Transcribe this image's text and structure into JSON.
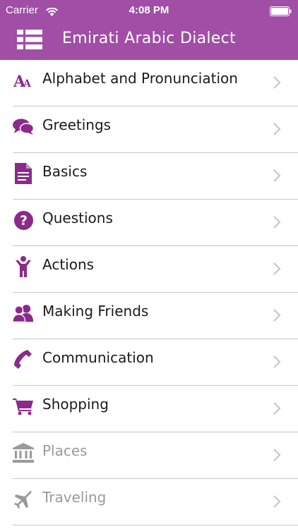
{
  "status_bar": {
    "carrier": "Carrier",
    "time": "4:08 PM"
  },
  "header": {
    "title": "Emirati Arabic Dialect"
  },
  "colors": {
    "accent": "#a04ea6",
    "icon": "#8b2a8b",
    "disabled": "#9a9a9a"
  },
  "items": [
    {
      "label": "Alphabet and Pronunciation",
      "icon": "font-size-icon",
      "enabled": true
    },
    {
      "label": "Greetings",
      "icon": "chat-bubbles-icon",
      "enabled": true
    },
    {
      "label": "Basics",
      "icon": "document-icon",
      "enabled": true
    },
    {
      "label": "Questions",
      "icon": "question-circle-icon",
      "enabled": true
    },
    {
      "label": "Actions",
      "icon": "person-icon",
      "enabled": true
    },
    {
      "label": "Making Friends",
      "icon": "users-icon",
      "enabled": true
    },
    {
      "label": "Communication",
      "icon": "phone-icon",
      "enabled": true
    },
    {
      "label": "Shopping",
      "icon": "cart-icon",
      "enabled": true
    },
    {
      "label": "Places",
      "icon": "bank-icon",
      "enabled": false
    },
    {
      "label": "Traveling",
      "icon": "airplane-icon",
      "enabled": false
    }
  ]
}
